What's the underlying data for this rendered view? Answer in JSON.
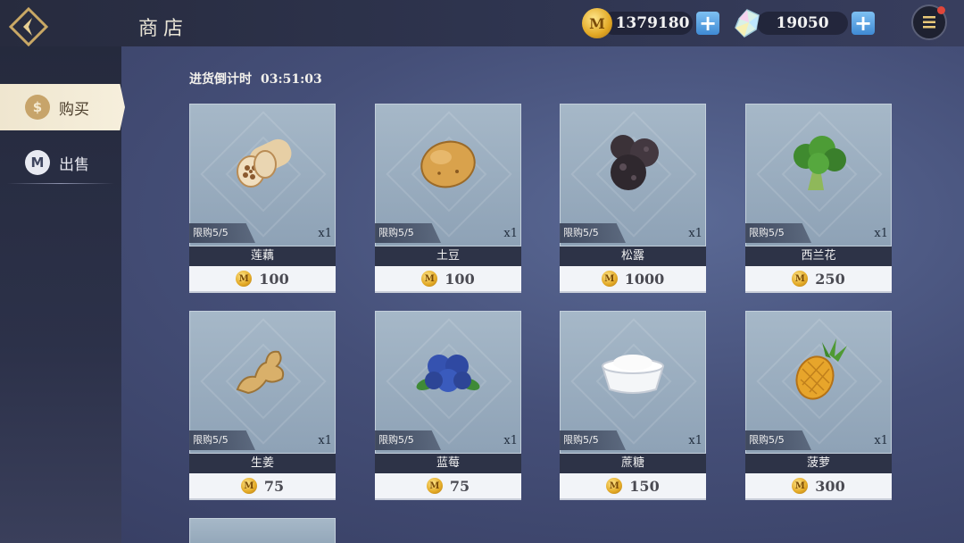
{
  "header": {
    "title": "商店"
  },
  "currency": {
    "coins": "1379180",
    "gems": "19050",
    "coin_glyph": "M",
    "plus_glyph": "+",
    "accent": "#3f8ad4"
  },
  "sidebar": {
    "buy_label": "购买",
    "sell_label": "出售",
    "buy_icon_glyph": "$",
    "sell_icon_glyph": "M"
  },
  "timer": {
    "label": "进货倒计时",
    "value": "03:51:03"
  },
  "items": [
    {
      "name": "莲藕",
      "limit": "限购5/5",
      "qty": "x1",
      "price": "100",
      "icon": "lotus-root-icon"
    },
    {
      "name": "土豆",
      "limit": "限购5/5",
      "qty": "x1",
      "price": "100",
      "icon": "potato-icon"
    },
    {
      "name": "松露",
      "limit": "限购5/5",
      "qty": "x1",
      "price": "1000",
      "icon": "truffle-icon"
    },
    {
      "name": "西兰花",
      "limit": "限购5/5",
      "qty": "x1",
      "price": "250",
      "icon": "broccoli-icon"
    },
    {
      "name": "生姜",
      "limit": "限购5/5",
      "qty": "x1",
      "price": "75",
      "icon": "ginger-icon"
    },
    {
      "name": "蓝莓",
      "limit": "限购5/5",
      "qty": "x1",
      "price": "75",
      "icon": "blueberry-icon"
    },
    {
      "name": "蔗糖",
      "limit": "限购5/5",
      "qty": "x1",
      "price": "150",
      "icon": "sugar-icon"
    },
    {
      "name": "菠萝",
      "limit": "限购5/5",
      "qty": "x1",
      "price": "300",
      "icon": "pineapple-icon"
    }
  ]
}
